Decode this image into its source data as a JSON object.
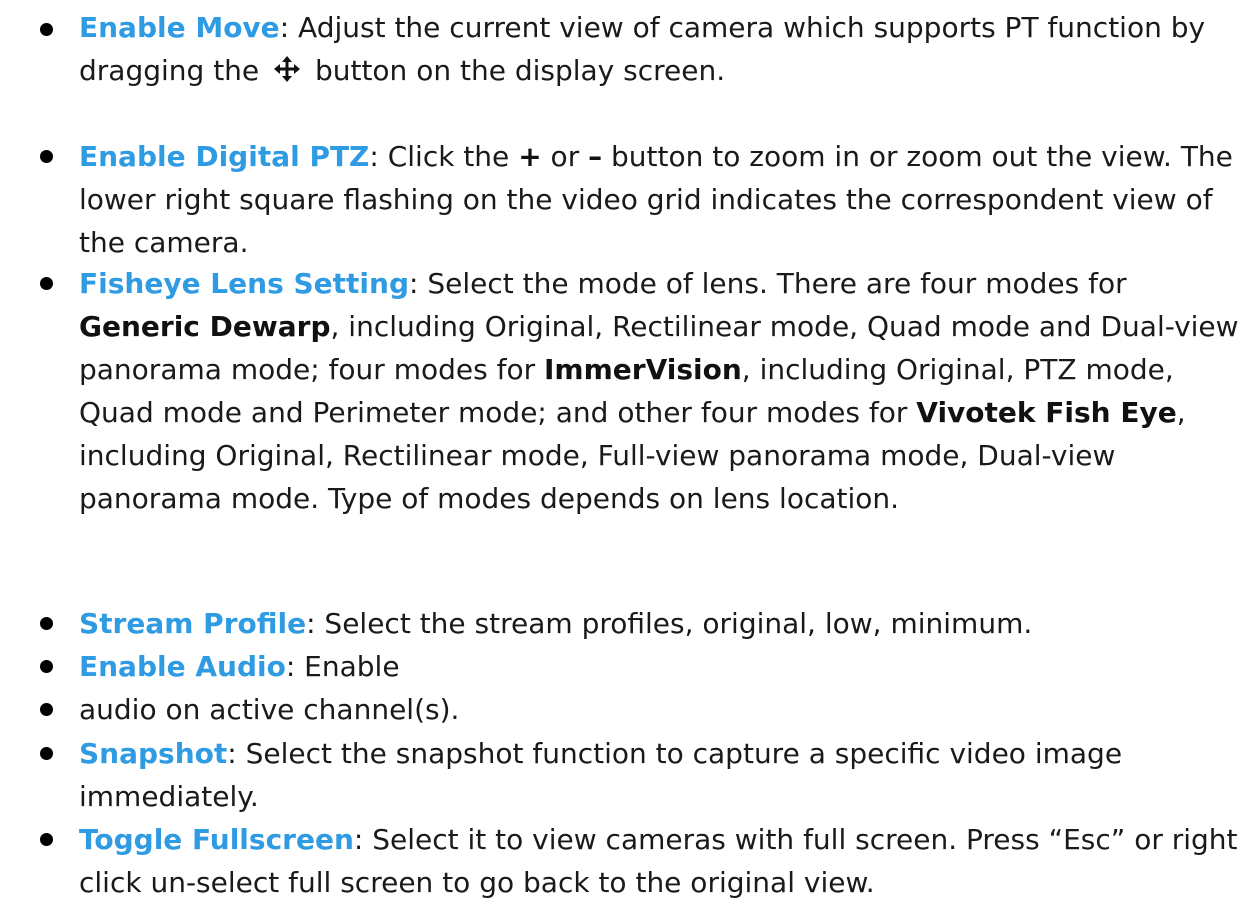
{
  "items": [
    {
      "term": "Enable Move",
      "sep": ":",
      "text_a": " Adjust the current view of camera which supports PT function by dragging the ",
      "icon": "move-arrows-icon",
      "text_b": " button on the display screen."
    },
    {
      "term": "Enable Digital PTZ",
      "sep": ":",
      "text_a": " Click the ",
      "plus": "+",
      "text_b": " or ",
      "minus": "–",
      "text_c": " button to zoom in or zoom out the view. The lower right square flashing on the video grid indicates the correspondent view of the camera."
    },
    {
      "term": "Fisheye Lens Setting",
      "sep": ":",
      "text_a": " Select the mode of lens. There are four modes for ",
      "brand1": "Generic Dewarp",
      "text_b": ", including Original, Rectilinear mode, Quad mode and Dual-view panorama mode; four modes for ",
      "brand2": "ImmerVision",
      "text_c": ", including Original, PTZ mode, Quad mode and Perimeter mode; and other four modes for ",
      "brand3": "Vivotek Fish Eye",
      "text_d": ", including Original, Rectilinear mode, Full-view panorama mode, Dual-view panorama mode. Type of modes depends on lens location."
    },
    {
      "term": "Stream Profile",
      "sep": ":",
      "text_a": " Select the stream profiles, original, low, minimum."
    },
    {
      "term": "Enable Audio",
      "sep": ":",
      "text_a": " Enable"
    },
    {
      "text_a": "audio on active channel(s)."
    },
    {
      "term": "Snapshot",
      "sep": ":",
      "text_a": " Select the snapshot function to capture a specific video image immediately."
    },
    {
      "term": "Toggle Fullscreen",
      "sep": ":",
      "text_a": " Select it to view cameras with full screen. Press “Esc” or right click un-select full screen to go back to the original view."
    }
  ],
  "colors": {
    "term": "#2f9be3",
    "text": "#1a1a1a",
    "bullet": "#000000"
  }
}
